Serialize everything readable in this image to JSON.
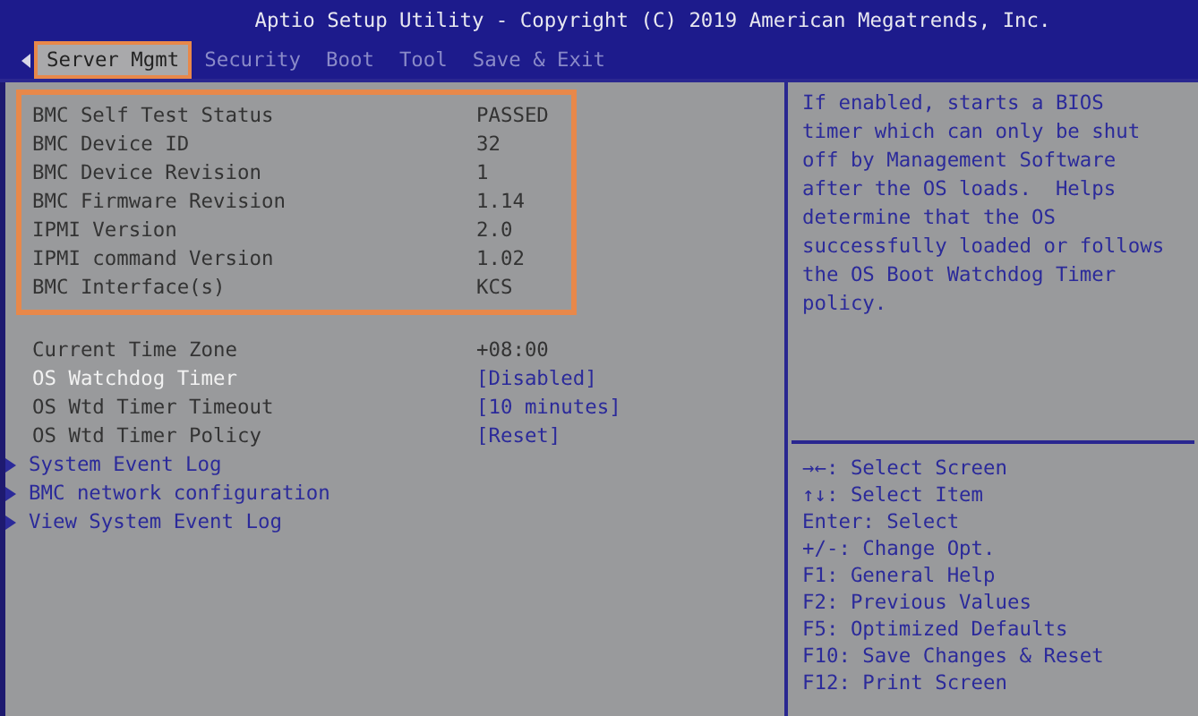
{
  "window": {
    "title": "Aptio Setup Utility - Copyright (C) 2019 American Megatrends, Inc."
  },
  "tabs": [
    {
      "label": "Server Mgmt",
      "selected": true,
      "highlighted": true
    },
    {
      "label": "Security",
      "selected": false,
      "highlighted": false
    },
    {
      "label": "Boot",
      "selected": false,
      "highlighted": false
    },
    {
      "label": "Tool",
      "selected": false,
      "highlighted": false
    },
    {
      "label": "Save & Exit",
      "selected": false,
      "highlighted": false
    }
  ],
  "info_group": {
    "highlighted": true,
    "rows": [
      {
        "label": "BMC Self Test Status",
        "value": "PASSED"
      },
      {
        "label": "BMC Device ID",
        "value": "32"
      },
      {
        "label": "BMC Device Revision",
        "value": "1"
      },
      {
        "label": "BMC Firmware Revision",
        "value": "1.14"
      },
      {
        "label": "IPMI Version",
        "value": "2.0"
      },
      {
        "label": "IPMI command Version",
        "value": "1.02"
      },
      {
        "label": "BMC Interface(s)",
        "value": "KCS"
      }
    ]
  },
  "items": [
    {
      "kind": "info",
      "label": "Current Time Zone",
      "value": "+08:00",
      "selected": false
    },
    {
      "kind": "setting",
      "label": "OS Watchdog Timer",
      "value": "[Disabled]",
      "selected": true
    },
    {
      "kind": "setting",
      "label": "OS Wtd Timer Timeout",
      "value": "[10 minutes]",
      "selected": false
    },
    {
      "kind": "setting",
      "label": "OS Wtd Timer Policy",
      "value": "[Reset]",
      "selected": false
    },
    {
      "kind": "submenu",
      "label": "System Event Log",
      "selected": false
    },
    {
      "kind": "submenu",
      "label": "BMC network configuration",
      "selected": false
    },
    {
      "kind": "submenu",
      "label": "View System Event Log",
      "selected": false
    }
  ],
  "help": {
    "text": "If enabled, starts a BIOS timer which can only be shut off by Management Software after the OS loads.  Helps determine that the OS successfully loaded or follows the OS Boot Watchdog Timer policy."
  },
  "keys": [
    "→←: Select Screen",
    "↑↓: Select Item",
    "Enter: Select",
    "+/-: Change Opt.",
    "F1: General Help",
    "F2: Previous Values",
    "F5: Optimized Defaults",
    "F10: Save Changes & Reset",
    "F12: Print Screen"
  ]
}
